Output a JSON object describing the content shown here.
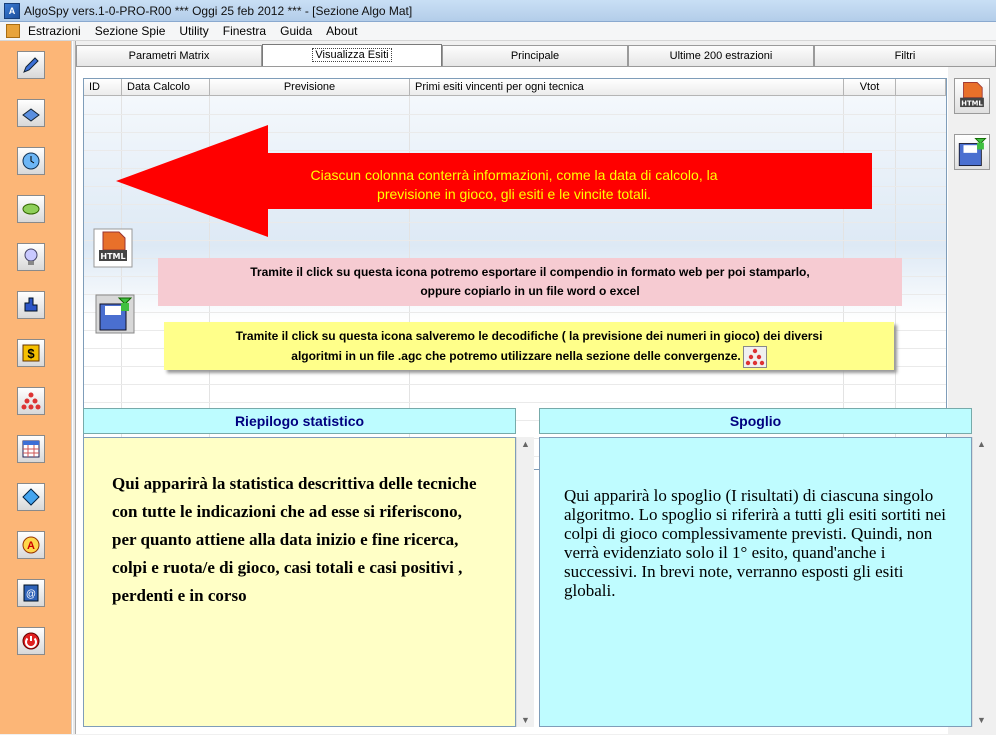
{
  "window": {
    "title": "AlgoSpy vers.1-0-PRO-R00  ***  Oggi 25 feb 2012  ***   - [Sezione Algo Mat]"
  },
  "menu": [
    "Estrazioni",
    "Sezione Spie",
    "Utility",
    "Finestra",
    "Guida",
    "About"
  ],
  "tabs": [
    "Parametri Matrix",
    "Visualizza Esiti",
    "Principale",
    "Ultime 200 estrazioni",
    "Filtri"
  ],
  "active_tab": "Visualizza Esiti",
  "grid": {
    "columns": [
      "ID",
      "Data Calcolo",
      "Previsione",
      "Primi esiti vincenti per ogni tecnica",
      "Vtot"
    ]
  },
  "annotations": {
    "arrow_line1": "Ciascun colonna conterrà informazioni, come la data di calcolo, la",
    "arrow_line2": "previsione in gioco, gli esiti e le vincite totali.",
    "html_line1": "Tramite il click su questa icona potremo esportare il compendio in formato web per poi stamparlo,",
    "html_line2": "oppure copiarlo in un file word o excel",
    "save_line1": "Tramite il click su questa icona salveremo le decodifiche ( la previsione dei numeri in gioco) dei diversi",
    "save_line2": "algoritmi in un file .agc che potremo utilizzare nella sezione delle convergenze."
  },
  "icons": {
    "html_label": "HTML"
  },
  "sections": {
    "riepilogo_title": "Riepilogo statistico",
    "riepilogo_text": "Qui apparirà la statistica descrittiva delle tecniche con tutte le indicazioni che ad esse si riferiscono, per quanto attiene alla data inizio e fine ricerca, colpi e ruota/e di gioco, casi totali e casi positivi , perdenti e in corso",
    "spoglio_title": "Spoglio",
    "spoglio_text": "Qui apparirà lo spoglio (I risultati) di ciascuna singolo algoritmo. Lo spoglio si riferirà a tutti gli esiti sortiti nei colpi di gioco complessivamente previsti. Quindi, non verrà evidenziato solo il 1° esito, quand'anche i successivi. In brevi note, verranno esposti gli esiti globali."
  },
  "colors": {
    "sidebar": "#fcb677",
    "arrow": "#ff0000",
    "arrow_text": "#ffff00",
    "section_header": "#bdfcff",
    "riepilogo_bg": "#ffffc6",
    "spoglio_bg": "#bffcff"
  }
}
